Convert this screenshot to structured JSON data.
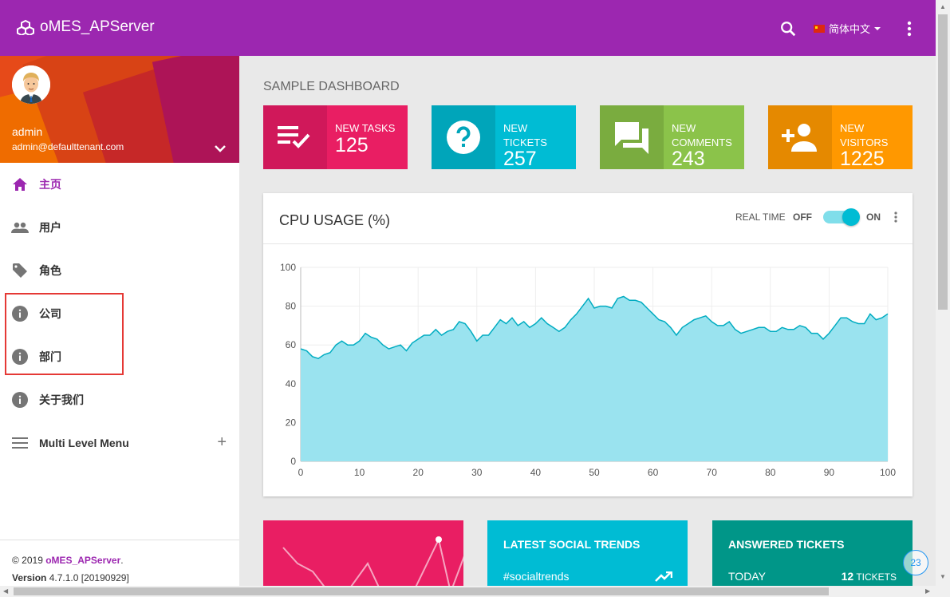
{
  "app": {
    "title": "oMES_APServer",
    "language": "简体中文"
  },
  "user": {
    "name": "admin",
    "email": "admin@defaulttenant.com"
  },
  "sidebar": {
    "items": [
      {
        "label": "主页",
        "icon": "home-icon",
        "active": true
      },
      {
        "label": "用户",
        "icon": "people-icon"
      },
      {
        "label": "角色",
        "icon": "tag-icon"
      },
      {
        "label": "公司",
        "icon": "info-icon"
      },
      {
        "label": "部门",
        "icon": "info-icon"
      },
      {
        "label": "关于我们",
        "icon": "info-icon"
      },
      {
        "label": "Multi Level Menu",
        "icon": "menu-icon",
        "expand": "+"
      }
    ],
    "footer": {
      "copyright": "© 2019",
      "brand": "oMES_APServer",
      "dot": ".",
      "version_label": "Version",
      "version": "4.7.1.0 [20190929]"
    }
  },
  "dashboard": {
    "title": "SAMPLE DASHBOARD",
    "cards": [
      {
        "label": "NEW TASKS",
        "value": "125",
        "color": "#e91e63",
        "dark": "#d0185a",
        "icon": "playlist-check-icon"
      },
      {
        "label": "NEW TICKETS",
        "value": "257",
        "color": "#00bcd4",
        "dark": "#00a5ba",
        "icon": "help-circle-icon"
      },
      {
        "label": "NEW COMMENTS",
        "value": "243",
        "color": "#8bc34a",
        "dark": "#7aac3f",
        "icon": "forum-icon"
      },
      {
        "label": "NEW VISITORS",
        "value": "1225",
        "color": "#ff9800",
        "dark": "#e58900",
        "icon": "person-add-icon"
      }
    ]
  },
  "cpu": {
    "title": "CPU USAGE (%)",
    "realtime": "REAL TIME",
    "off": "OFF",
    "on": "ON",
    "toggle_on": true
  },
  "chart_data": {
    "type": "area",
    "x": [
      0,
      1,
      2,
      3,
      4,
      5,
      6,
      7,
      8,
      9,
      10,
      11,
      12,
      13,
      14,
      15,
      16,
      17,
      18,
      19,
      20,
      21,
      22,
      23,
      24,
      25,
      26,
      27,
      28,
      29,
      30,
      31,
      32,
      33,
      34,
      35,
      36,
      37,
      38,
      39,
      40,
      41,
      42,
      43,
      44,
      45,
      46,
      47,
      48,
      49,
      50,
      51,
      52,
      53,
      54,
      55,
      56,
      57,
      58,
      59,
      60,
      61,
      62,
      63,
      64,
      65,
      66,
      67,
      68,
      69,
      70,
      71,
      72,
      73,
      74,
      75,
      76,
      77,
      78,
      79,
      80,
      81,
      82,
      83,
      84,
      85,
      86,
      87,
      88,
      89,
      90,
      91,
      92,
      93,
      94,
      95,
      96,
      97,
      98,
      99,
      100
    ],
    "values": [
      58,
      57,
      54,
      53,
      55,
      56,
      60,
      62,
      60,
      60,
      62,
      66,
      64,
      63,
      60,
      58,
      59,
      60,
      57,
      61,
      63,
      65,
      65,
      68,
      65,
      67,
      68,
      72,
      71,
      67,
      62,
      65,
      65,
      69,
      73,
      71,
      74,
      70,
      72,
      69,
      71,
      74,
      71,
      69,
      67,
      69,
      73,
      76,
      80,
      84,
      79,
      80,
      80,
      79,
      84,
      85,
      83,
      83,
      82,
      79,
      76,
      73,
      72,
      69,
      65,
      69,
      71,
      73,
      74,
      75,
      72,
      70,
      70,
      72,
      68,
      66,
      67,
      68,
      69,
      69,
      67,
      67,
      69,
      68,
      68,
      70,
      69,
      66,
      66,
      63,
      66,
      70,
      74,
      74,
      72,
      71,
      71,
      76,
      73,
      74,
      76
    ],
    "xlim": [
      0,
      100
    ],
    "ylim": [
      0,
      100
    ],
    "xticks": [
      0,
      10,
      20,
      30,
      40,
      50,
      60,
      70,
      80,
      90,
      100
    ],
    "yticks": [
      0,
      20,
      40,
      60,
      80,
      100
    ],
    "grid": true,
    "fill": "#9ae3ef",
    "line": "#00acc1"
  },
  "widgets": [
    {
      "title": "",
      "color": "#e91e63"
    },
    {
      "title": "LATEST SOCIAL TRENDS",
      "sub": "#socialtrends",
      "color": "#00bcd4"
    },
    {
      "title": "ANSWERED TICKETS",
      "sub": "TODAY",
      "value": "12",
      "unit": "TICKETS",
      "color": "#009688"
    }
  ],
  "badge": "23"
}
